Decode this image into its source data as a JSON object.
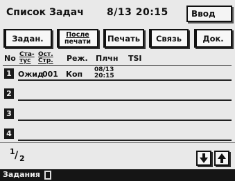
{
  "header": {
    "title": "Список Задач",
    "datetime": "8/13 20:15",
    "enter_label": "Ввод"
  },
  "tabs": {
    "jobs": "Задан.",
    "after_line1": "После",
    "after_line2": "печати",
    "print": "Печать",
    "comm": "Связь",
    "doc": "Док."
  },
  "columns": {
    "no": "No",
    "status_line1": "Ста-",
    "status_line2": "тус",
    "pages_line1": "Ост.",
    "pages_line2": "Стр.",
    "mode": "Реж.",
    "time": "Плчн",
    "tsi": "TSI"
  },
  "rows": [
    {
      "num": "1",
      "status": "Ожид",
      "pages": "001",
      "mode": "Коп",
      "time_line1": "08/13",
      "time_line2": "20:15",
      "selected": true
    },
    {
      "num": "2",
      "status": "",
      "pages": "",
      "mode": "",
      "time_line1": "",
      "time_line2": "",
      "selected": false
    },
    {
      "num": "3",
      "status": "",
      "pages": "",
      "mode": "",
      "time_line1": "",
      "time_line2": "",
      "selected": false
    },
    {
      "num": "4",
      "status": "",
      "pages": "",
      "mode": "",
      "time_line1": "",
      "time_line2": "",
      "selected": false
    }
  ],
  "pagination": {
    "current": "1",
    "total": "2"
  },
  "icons": {
    "down": "arrow-down-icon",
    "up": "arrow-up-icon",
    "doc": "document-icon"
  },
  "statusbar": {
    "label": "Задания"
  }
}
